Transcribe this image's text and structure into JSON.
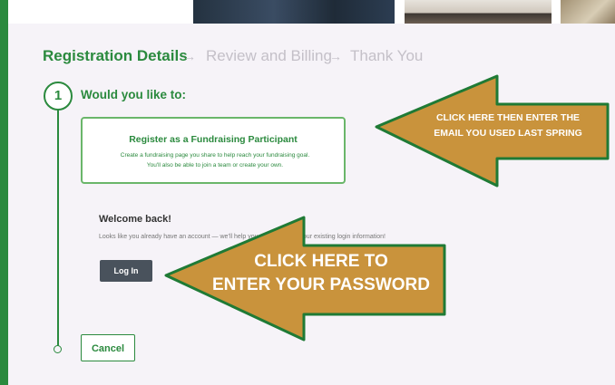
{
  "steps": {
    "step1": "Registration Details",
    "step2": "Review and Billing",
    "step3": "Thank You",
    "separator": "→"
  },
  "registration": {
    "step_number": "1",
    "question": "Would you like to:",
    "option_title": "Register as a Fundraising Participant",
    "option_desc_line1": "Create a fundraising page you share to help reach your fundraising goal.",
    "option_desc_line2": "You'll also be able to join a team or create your own."
  },
  "welcome": {
    "title": "Welcome back!",
    "text": "Looks like you already have an account — we’ll help you register using your existing login information!",
    "login_label": "Log In"
  },
  "cancel_label": "Cancel",
  "callouts": {
    "top_line1": "CLICK HERE THEN ENTER THE",
    "top_line2": "EMAIL YOU USED LAST SPRING",
    "bottom_line1": "CLICK HERE TO",
    "bottom_line2": "ENTER YOUR PASSWORD"
  },
  "colors": {
    "brand_green": "#2b8a3e",
    "callout_fill": "#c9933c",
    "callout_border": "#1f7a35",
    "login_button": "#49525c"
  }
}
